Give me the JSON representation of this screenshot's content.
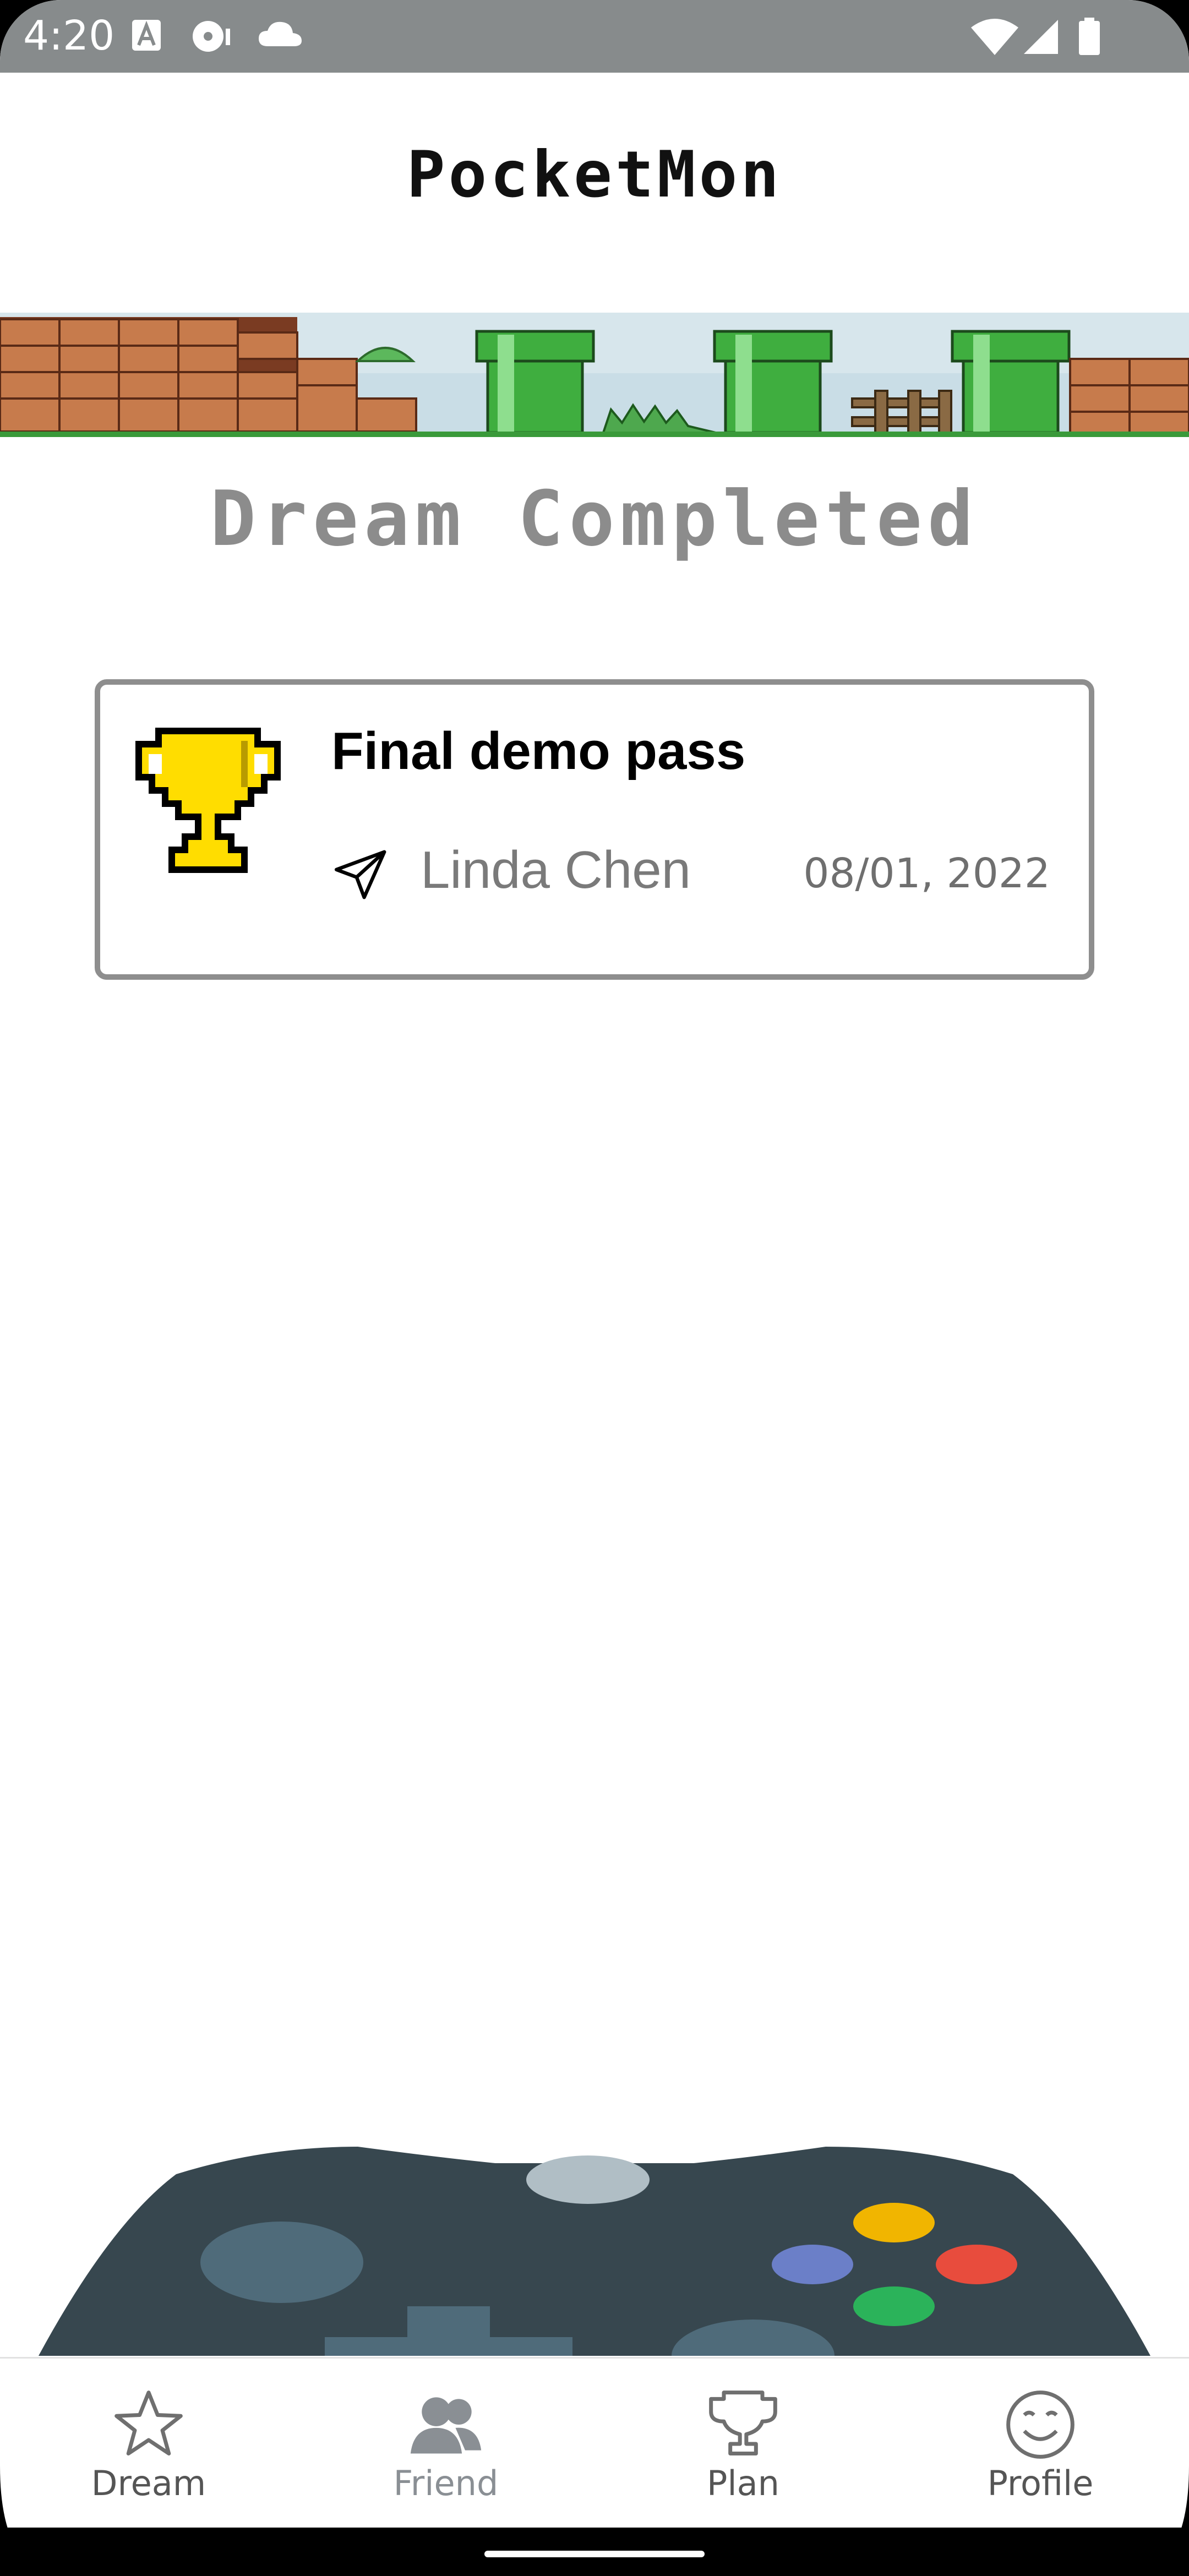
{
  "status_bar": {
    "time": "4:20",
    "icons": [
      "a-letter-icon",
      "disc-icon",
      "cloud-icon",
      "wifi-icon",
      "signal-icon",
      "battery-icon"
    ]
  },
  "header": {
    "title": "PocketMon"
  },
  "section": {
    "title": "Dream Completed"
  },
  "dreams": [
    {
      "title": "Final demo pass",
      "user": "Linda Chen",
      "date": "08/01, 2022",
      "icon": "trophy-icon"
    }
  ],
  "bottom_nav": {
    "items": [
      {
        "label": "Dream",
        "icon": "star-icon",
        "active": false
      },
      {
        "label": "Friend",
        "icon": "friends-icon",
        "active": true
      },
      {
        "label": "Plan",
        "icon": "trophy-icon",
        "active": false
      },
      {
        "label": "Profile",
        "icon": "smiley-icon",
        "active": false
      }
    ]
  },
  "colors": {
    "status_bar": "#878b8c",
    "section_title": "#8c8c8c",
    "card_border": "#8e8e8e",
    "trophy": "#ffdd00",
    "controller": "#37474f"
  }
}
